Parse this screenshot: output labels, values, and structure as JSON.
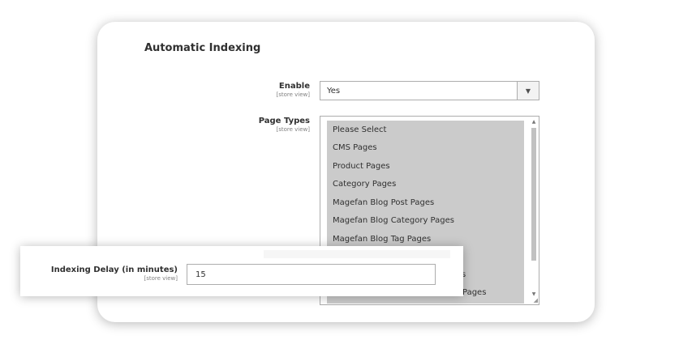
{
  "section": {
    "title": "Automatic Indexing"
  },
  "enable": {
    "label": "Enable",
    "scope": "[store view]",
    "value": "Yes"
  },
  "page_types": {
    "label": "Page Types",
    "scope": "[store view]",
    "options": [
      "Please Select",
      "CMS Pages",
      "Product Pages",
      "Category Pages",
      "Magefan Blog Post Pages",
      "Magefan Blog Category Pages",
      "Magefan Blog Tag Pages"
    ],
    "partial_visible": [
      "s",
      "Pages"
    ]
  },
  "indexing_delay": {
    "label": "Indexing Delay (in minutes)",
    "scope": "[store view]",
    "value": "15"
  },
  "icons": {
    "dropdown": "chevron-down-icon",
    "scroll_up": "scroll-up-icon",
    "scroll_down": "scroll-down-icon",
    "resize": "resize-handle-icon"
  },
  "colors": {
    "selected_bg": "#cbcbcb",
    "border": "#adadad"
  }
}
